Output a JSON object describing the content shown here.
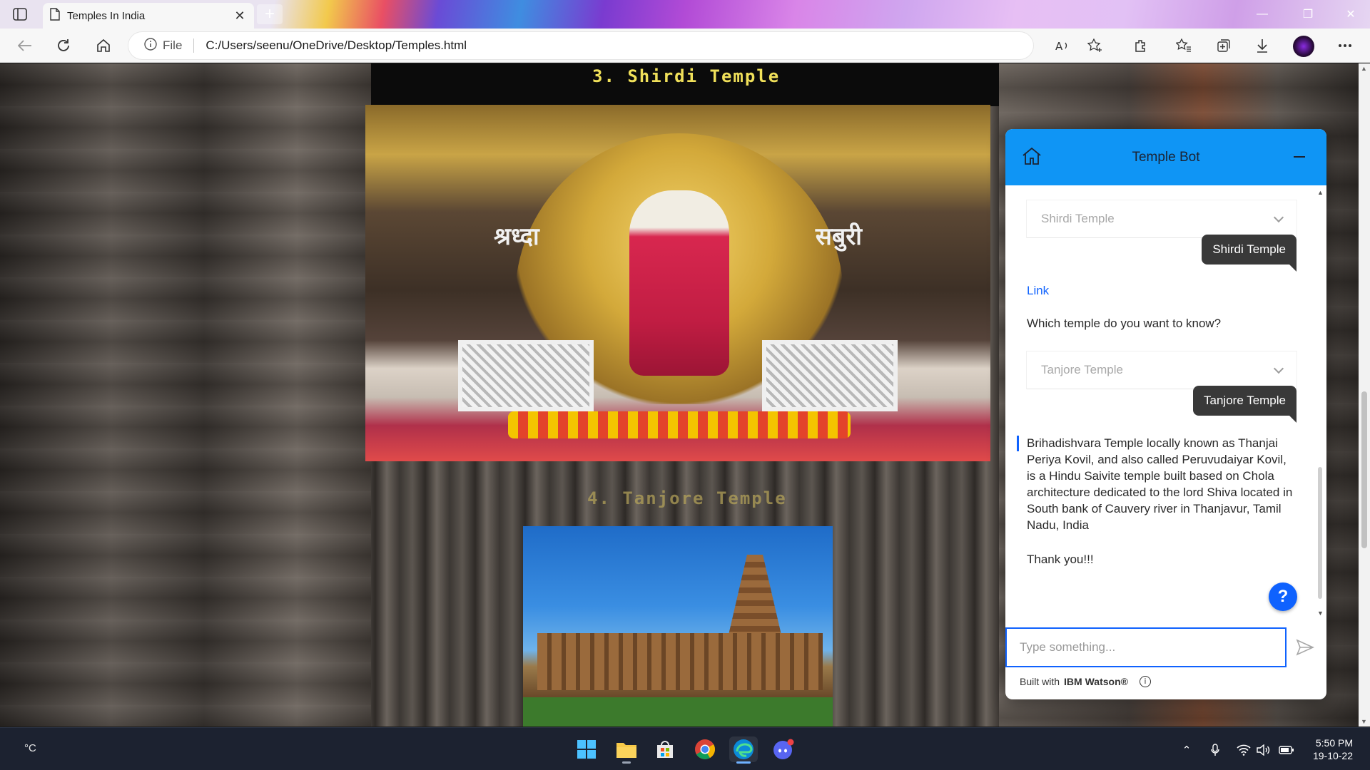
{
  "browser": {
    "tab_title": "Temples In India",
    "address_prefix": "File",
    "url": "C:/Users/seenu/OneDrive/Desktop/Temples.html"
  },
  "page": {
    "heading_3": "3. Shirdi Temple",
    "heading_4": "4. Tanjore Temple",
    "shirdi_banner_left": "श्रध्दा",
    "shirdi_banner_right": "सबुरी"
  },
  "chat": {
    "title": "Temple Bot",
    "dropdown_1": "Shirdi Temple",
    "user_msg_1": "Shirdi Temple",
    "link_text": "Link",
    "question": "Which temple do you want to know?",
    "dropdown_2": "Tanjore Temple",
    "user_msg_2": "Tanjore Temple",
    "answer": "Brihadishvara Temple locally known as Thanjai Periya Kovil, and also called Peruvudaiyar Kovil, is a Hindu Saivite temple built based on Chola architecture dedicated to the lord Shiva located in South bank of Cauvery river in Thanjavur, Tamil Nadu, India",
    "thanks": "Thank you!!!",
    "input_placeholder": "Type something...",
    "footer_prefix": "Built with",
    "footer_brand": "IBM Watson®",
    "help_label": "?",
    "accent_color": "#0f95f5"
  },
  "taskbar": {
    "weather": "°C",
    "time": "5:50 PM",
    "date": "19-10-22"
  }
}
